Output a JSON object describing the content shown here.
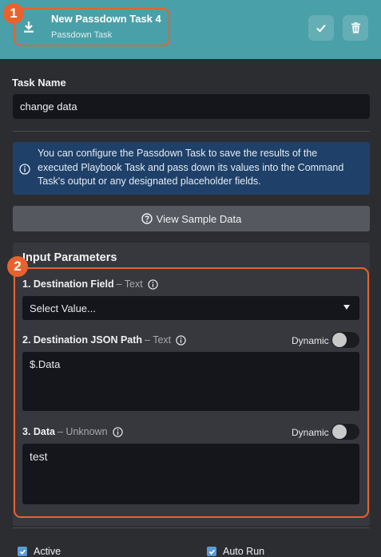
{
  "header": {
    "title": "New Passdown Task 4",
    "subtitle": "Passdown Task",
    "accent_color": "#4aa0a8",
    "icons": {
      "task": "download-icon",
      "confirm": "check-icon",
      "delete": "trash-icon"
    }
  },
  "annotations": {
    "badge_1": "1",
    "badge_2": "2",
    "color": "#e8622e"
  },
  "task_name": {
    "label": "Task Name",
    "value": "change data"
  },
  "info": {
    "icon": "info-icon",
    "text": "You can configure the Passdown Task to save the results of the executed Playbook Task and pass down its values into the Command Task's output or any designated placeholder fields."
  },
  "sample_button": {
    "label": "View Sample Data",
    "icon": "question-circle-icon"
  },
  "input_parameters": {
    "title": "Input Parameters",
    "fields": [
      {
        "label": "1. Destination Field",
        "type": "– Text",
        "placeholder": "Select Value..."
      },
      {
        "label": "2. Destination JSON Path",
        "type": "– Text",
        "dynamic_label": "Dynamic",
        "dynamic_on": false,
        "value": "$.Data"
      },
      {
        "label": "3. Data",
        "type": "– Unknown",
        "dynamic_label": "Dynamic",
        "dynamic_on": false,
        "value": "test"
      }
    ]
  },
  "footer": {
    "active_label": "Active",
    "active_checked": true,
    "autorun_label": "Auto Run",
    "autorun_checked": true
  }
}
